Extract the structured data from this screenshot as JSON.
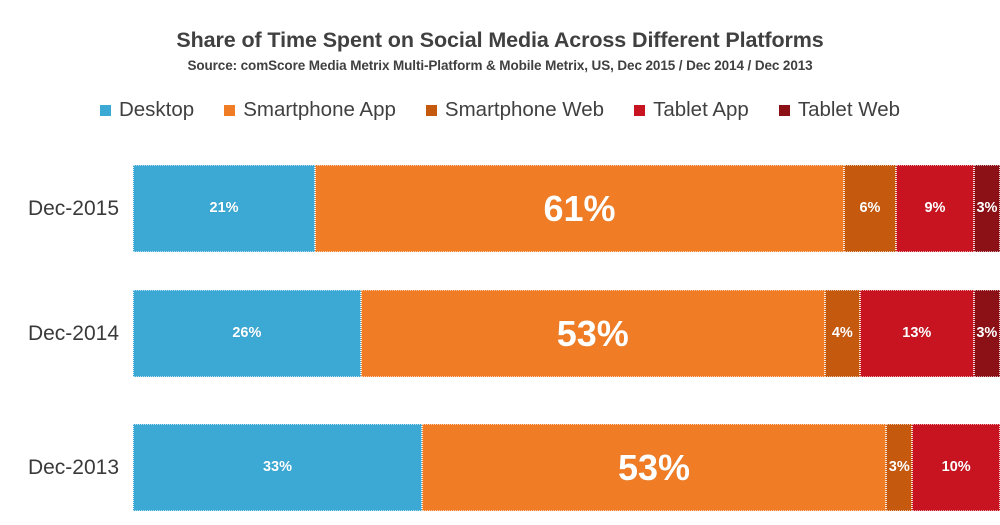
{
  "header": {
    "title": "Share of Time Spent on Social Media Across Different Platforms",
    "subtitle": "Source: comScore Media Metrix Multi-Platform & Mobile Metrix, US, Dec 2015 / Dec 2014 / Dec 2013"
  },
  "chart_data": {
    "type": "bar",
    "orientation": "horizontal",
    "stacked": true,
    "stack_mode": "percent",
    "title": "Share of Time Spent on Social Media Across Different Platforms",
    "subtitle": "Source: comScore Media Metrix Multi-Platform & Mobile Metrix, US, Dec 2015 / Dec 2014 / Dec 2013",
    "xlabel": "",
    "ylabel": "",
    "xlim": [
      0,
      100
    ],
    "grid": false,
    "legend_position": "top-center",
    "categories": [
      "Dec-2015",
      "Dec-2014",
      "Dec-2013"
    ],
    "series": [
      {
        "name": "Desktop",
        "color": "#3BA9D4",
        "values": [
          21,
          26,
          33
        ],
        "labels": [
          "21%",
          "26%",
          "33%"
        ]
      },
      {
        "name": "Smartphone App",
        "color": "#F07D26",
        "values": [
          61,
          53,
          53
        ],
        "labels": [
          "61%",
          "53%",
          "53%"
        ]
      },
      {
        "name": "Smartphone Web",
        "color": "#C5590E",
        "values": [
          6,
          4,
          3
        ],
        "labels": [
          "6%",
          "4%",
          "3%"
        ]
      },
      {
        "name": "Tablet App",
        "color": "#C81420",
        "values": [
          9,
          13,
          10
        ],
        "labels": [
          "9%",
          "13%",
          "10%"
        ]
      },
      {
        "name": "Tablet Web",
        "color": "#8B1117",
        "values": [
          3,
          3,
          0
        ],
        "labels": [
          "3%",
          "3%",
          ""
        ]
      }
    ]
  },
  "legend": {
    "items": [
      {
        "label": "Desktop",
        "color": "#3BA9D4"
      },
      {
        "label": "Smartphone App",
        "color": "#F07D26"
      },
      {
        "label": "Smartphone Web",
        "color": "#C5590E"
      },
      {
        "label": "Tablet App",
        "color": "#C81420"
      },
      {
        "label": "Tablet Web",
        "color": "#8B1117"
      }
    ]
  },
  "rows": [
    {
      "label": "Dec-2015",
      "segments": [
        {
          "series": "Desktop",
          "value": 21,
          "label": "21%",
          "color": "#3BA9D4",
          "emphasis": "small"
        },
        {
          "series": "Smartphone App",
          "value": 61,
          "label": "61%",
          "color": "#F07D26",
          "emphasis": "big"
        },
        {
          "series": "Smartphone Web",
          "value": 6,
          "label": "6%",
          "color": "#C5590E",
          "emphasis": "small"
        },
        {
          "series": "Tablet App",
          "value": 9,
          "label": "9%",
          "color": "#C81420",
          "emphasis": "small"
        },
        {
          "series": "Tablet Web",
          "value": 3,
          "label": "3%",
          "color": "#8B1117",
          "emphasis": "small"
        }
      ]
    },
    {
      "label": "Dec-2014",
      "segments": [
        {
          "series": "Desktop",
          "value": 26,
          "label": "26%",
          "color": "#3BA9D4",
          "emphasis": "small"
        },
        {
          "series": "Smartphone App",
          "value": 53,
          "label": "53%",
          "color": "#F07D26",
          "emphasis": "big"
        },
        {
          "series": "Smartphone Web",
          "value": 4,
          "label": "4%",
          "color": "#C5590E",
          "emphasis": "small"
        },
        {
          "series": "Tablet App",
          "value": 13,
          "label": "13%",
          "color": "#C81420",
          "emphasis": "small"
        },
        {
          "series": "Tablet Web",
          "value": 3,
          "label": "3%",
          "color": "#8B1117",
          "emphasis": "small"
        }
      ]
    },
    {
      "label": "Dec-2013",
      "segments": [
        {
          "series": "Desktop",
          "value": 33,
          "label": "33%",
          "color": "#3BA9D4",
          "emphasis": "small"
        },
        {
          "series": "Smartphone App",
          "value": 53,
          "label": "53%",
          "color": "#F07D26",
          "emphasis": "big"
        },
        {
          "series": "Smartphone Web",
          "value": 3,
          "label": "3%",
          "color": "#C5590E",
          "emphasis": "small"
        },
        {
          "series": "Tablet App",
          "value": 10,
          "label": "10%",
          "color": "#C81420",
          "emphasis": "small"
        }
      ]
    }
  ]
}
